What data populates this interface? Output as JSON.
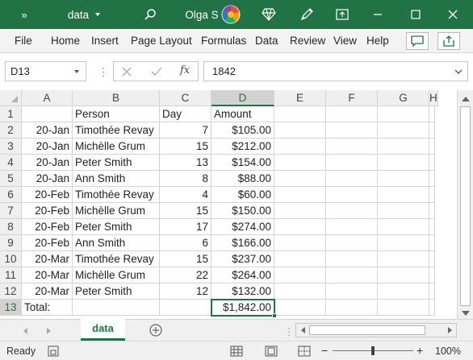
{
  "titlebar": {
    "filename": "data",
    "user": "Olga S",
    "colors": {
      "bar": "#217346"
    }
  },
  "ribbon": {
    "tabs": [
      "File",
      "Home",
      "Insert",
      "Page Layout",
      "Formulas",
      "Data",
      "Review",
      "View",
      "Help"
    ]
  },
  "formula_bar": {
    "name_box": "D13",
    "fx": "fx",
    "value": "1842"
  },
  "grid": {
    "columns": [
      "A",
      "B",
      "C",
      "D",
      "E",
      "F",
      "G",
      "H"
    ],
    "rows": [
      [
        "",
        "Person",
        "Day",
        "Amount"
      ],
      [
        "20-Jan",
        "Timothée Revay",
        "7",
        "$105.00"
      ],
      [
        "20-Jan",
        "Michèlle Grum",
        "15",
        "$212.00"
      ],
      [
        "20-Jan",
        "Peter Smith",
        "13",
        "$154.00"
      ],
      [
        "20-Jan",
        "Ann Smith",
        "8",
        "$88.00"
      ],
      [
        "20-Feb",
        "Timothée Revay",
        "4",
        "$60.00"
      ],
      [
        "20-Feb",
        "Michèlle Grum",
        "15",
        "$150.00"
      ],
      [
        "20-Feb",
        "Peter Smith",
        "17",
        "$274.00"
      ],
      [
        "20-Feb",
        "Ann Smith",
        "6",
        "$166.00"
      ],
      [
        "20-Mar",
        "Timothée Revay",
        "15",
        "$237.00"
      ],
      [
        "20-Mar",
        "Michèlle Grum",
        "22",
        "$264.00"
      ],
      [
        "20-Mar",
        "Peter Smith",
        "12",
        "$132.00"
      ],
      [
        "Total:",
        "",
        "",
        "$1,842.00"
      ]
    ],
    "row_numbers": [
      "1",
      "2",
      "3",
      "4",
      "5",
      "6",
      "7",
      "8",
      "9",
      "10",
      "11",
      "12",
      "13"
    ]
  },
  "sheets": {
    "active": "data"
  },
  "status": {
    "mode": "Ready",
    "zoom": "100%"
  }
}
